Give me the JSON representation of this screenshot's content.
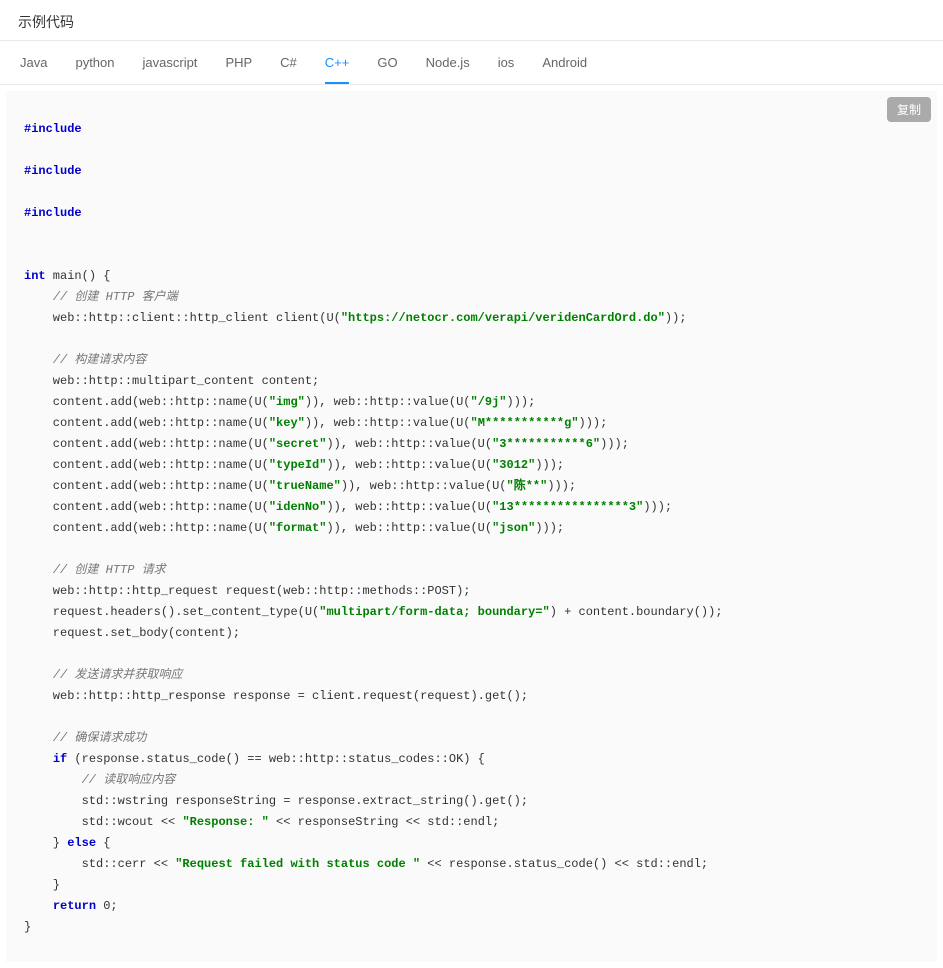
{
  "title": "示例代码",
  "tabs": [
    "Java",
    "python",
    "javascript",
    "PHP",
    "C#",
    "C++",
    "GO",
    "Node.js",
    "ios",
    "Android"
  ],
  "activeTab": "C++",
  "copyLabel": "复制",
  "code": {
    "pre_include": "#include",
    "kw_int": "int",
    "main_sig": " main() {",
    "c_client": "// 创建 HTTP 客户端",
    "l_client_pre": "    web::http::client::http_client client(U(",
    "url": "\"https://netocr.com/verapi/veridenCardOrd.do\"",
    "l_client_post": "));",
    "c_body": "// 构建请求内容",
    "l_content": "    web::http::multipart_content content;",
    "ap": "    content.add(web::http::name(U(",
    "am": ")), web::http::value(U(",
    "ae": ")));",
    "p0k": "\"img\"",
    "p0v": "\"/9j\"",
    "p1k": "\"key\"",
    "p1v": "\"M***********g\"",
    "p2k": "\"secret\"",
    "p2v": "\"3***********6\"",
    "p3k": "\"typeId\"",
    "p3v": "\"3012\"",
    "p4k": "\"trueName\"",
    "p4v": "\"陈**\"",
    "p5k": "\"idenNo\"",
    "p5v": "\"13****************3\"",
    "p6k": "\"format\"",
    "p6v": "\"json\"",
    "c_req": "// 创建 HTTP 请求",
    "l_req": "    web::http::http_request request(web::http::methods::POST);",
    "l_hdr_pre": "    request.headers().set_content_type(U(",
    "hdr_str": "\"multipart/form-data; boundary=\"",
    "l_hdr_post": ") + content.boundary());",
    "l_setbody": "    request.set_body(content);",
    "c_send": "// 发送请求并获取响应",
    "l_resp": "    web::http::http_response response = client.request(request).get();",
    "c_ok": "// 确保请求成功",
    "kw_if": "if",
    "if_cond": " (response.status_code() == web::http::status_codes::OK) {",
    "c_read": "// 读取响应内容",
    "l_extract": "        std::wstring responseString = response.extract_string().get();",
    "l_wcout_pre": "        std::wcout << ",
    "resp_str": "\"Response: \"",
    "l_wcout_post": " << responseString << std::endl;",
    "else_line_pre": "    } ",
    "kw_else": "else",
    "else_line_post": " {",
    "l_cerr_pre": "        std::cerr << ",
    "fail_str": "\"Request failed with status code \"",
    "l_cerr_post": " << response.status_code() << std::endl;",
    "cb": "    }",
    "kw_return": "return",
    "ret_tail": " 0;",
    "end": "}"
  }
}
